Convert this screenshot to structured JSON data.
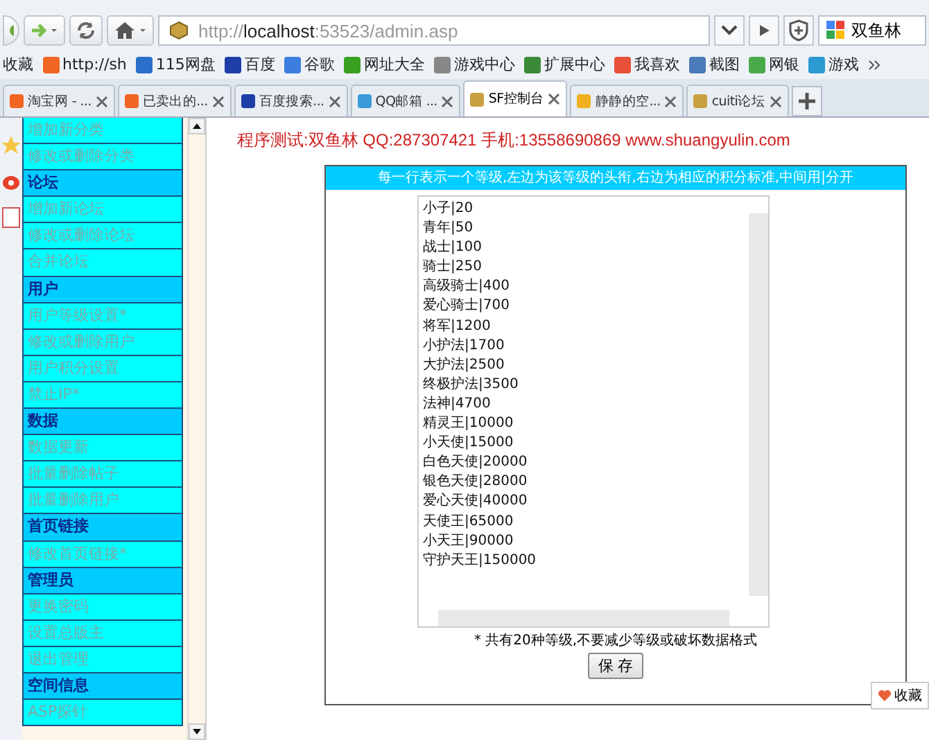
{
  "address_bar": {
    "url": "http://**localhost**:53523/admin.asp",
    "search_value": "双鱼林"
  },
  "bookmarks": [
    {
      "label": "收藏",
      "kind": "menu"
    },
    {
      "label": "http://sh",
      "kind": "taobao"
    },
    {
      "label": "115网盘",
      "kind": "s115"
    },
    {
      "label": "百度",
      "kind": "paw"
    },
    {
      "label": "谷歌",
      "kind": "google"
    },
    {
      "label": "网址大全",
      "kind": "plus"
    },
    {
      "label": "游戏中心",
      "kind": "gamepad"
    },
    {
      "label": "扩展中心",
      "kind": "cube"
    },
    {
      "label": "我喜欢",
      "kind": "heart"
    },
    {
      "label": "截图",
      "kind": "scissors"
    },
    {
      "label": "网银",
      "kind": "globe"
    },
    {
      "label": "游戏",
      "kind": "game"
    }
  ],
  "tabs": [
    {
      "title": "淘宝网 - ...",
      "kind": "taobao",
      "selected": false
    },
    {
      "title": "已卖出的...",
      "kind": "taobao",
      "selected": false
    },
    {
      "title": "百度搜索...",
      "kind": "paw",
      "selected": false
    },
    {
      "title": "QQ邮箱 ...",
      "kind": "ring",
      "selected": false
    },
    {
      "title": "SF控制台",
      "kind": "hex",
      "selected": true
    },
    {
      "title": "静静的空...",
      "kind": "star",
      "selected": false
    },
    {
      "title": "cuiti论坛",
      "kind": "hex",
      "selected": false
    }
  ],
  "sidebar": [
    {
      "label": "增加新分类",
      "kind": "link"
    },
    {
      "label": "修改或删除分类",
      "kind": "link"
    },
    {
      "label": "论坛",
      "kind": "header"
    },
    {
      "label": "增加新论坛",
      "kind": "link"
    },
    {
      "label": "修改或删除论坛",
      "kind": "link"
    },
    {
      "label": "合并论坛",
      "kind": "link"
    },
    {
      "label": "用户",
      "kind": "header"
    },
    {
      "label": "用户等级设置*",
      "kind": "link"
    },
    {
      "label": "修改或删除用户",
      "kind": "link"
    },
    {
      "label": "用户积分设置",
      "kind": "link"
    },
    {
      "label": "禁止IP*",
      "kind": "link"
    },
    {
      "label": "数据",
      "kind": "header"
    },
    {
      "label": "数据更新",
      "kind": "link"
    },
    {
      "label": "批量删除帖子",
      "kind": "link"
    },
    {
      "label": "批量删除用户",
      "kind": "link"
    },
    {
      "label": "首页链接",
      "kind": "header"
    },
    {
      "label": "修改首页链接*",
      "kind": "link"
    },
    {
      "label": "管理员",
      "kind": "header"
    },
    {
      "label": "更换密码",
      "kind": "link"
    },
    {
      "label": "设置总版主",
      "kind": "link"
    },
    {
      "label": "退出管理",
      "kind": "link"
    },
    {
      "label": "空间信息",
      "kind": "header"
    },
    {
      "label": "ASP探针",
      "kind": "link"
    }
  ],
  "page": {
    "credit": "程序测试:双鱼林 QQ:287307421 手机:13558690869 www.shuangyulin.com",
    "panel_header": "每一行表示一个等级,左边为该等级的头衔,右边为相应的积分标准,中间用|分开",
    "levels": [
      "小子|20",
      "青年|50",
      "战士|100",
      "骑士|250",
      "高级骑士|400",
      "爱心骑士|700",
      "将军|1200",
      "小护法|1700",
      "大护法|2500",
      "终极护法|3500",
      "法神|4700",
      "精灵王|10000",
      "小天使|15000",
      "白色天使|20000",
      "银色天使|28000",
      "爱心天使|40000",
      "天使王|65000",
      "小天王|90000",
      "守护天王|150000"
    ],
    "note": "* 共有20种等级,不要减少等级或破坏数据格式",
    "save_button": "保 存"
  },
  "favorites_button": "收藏"
}
